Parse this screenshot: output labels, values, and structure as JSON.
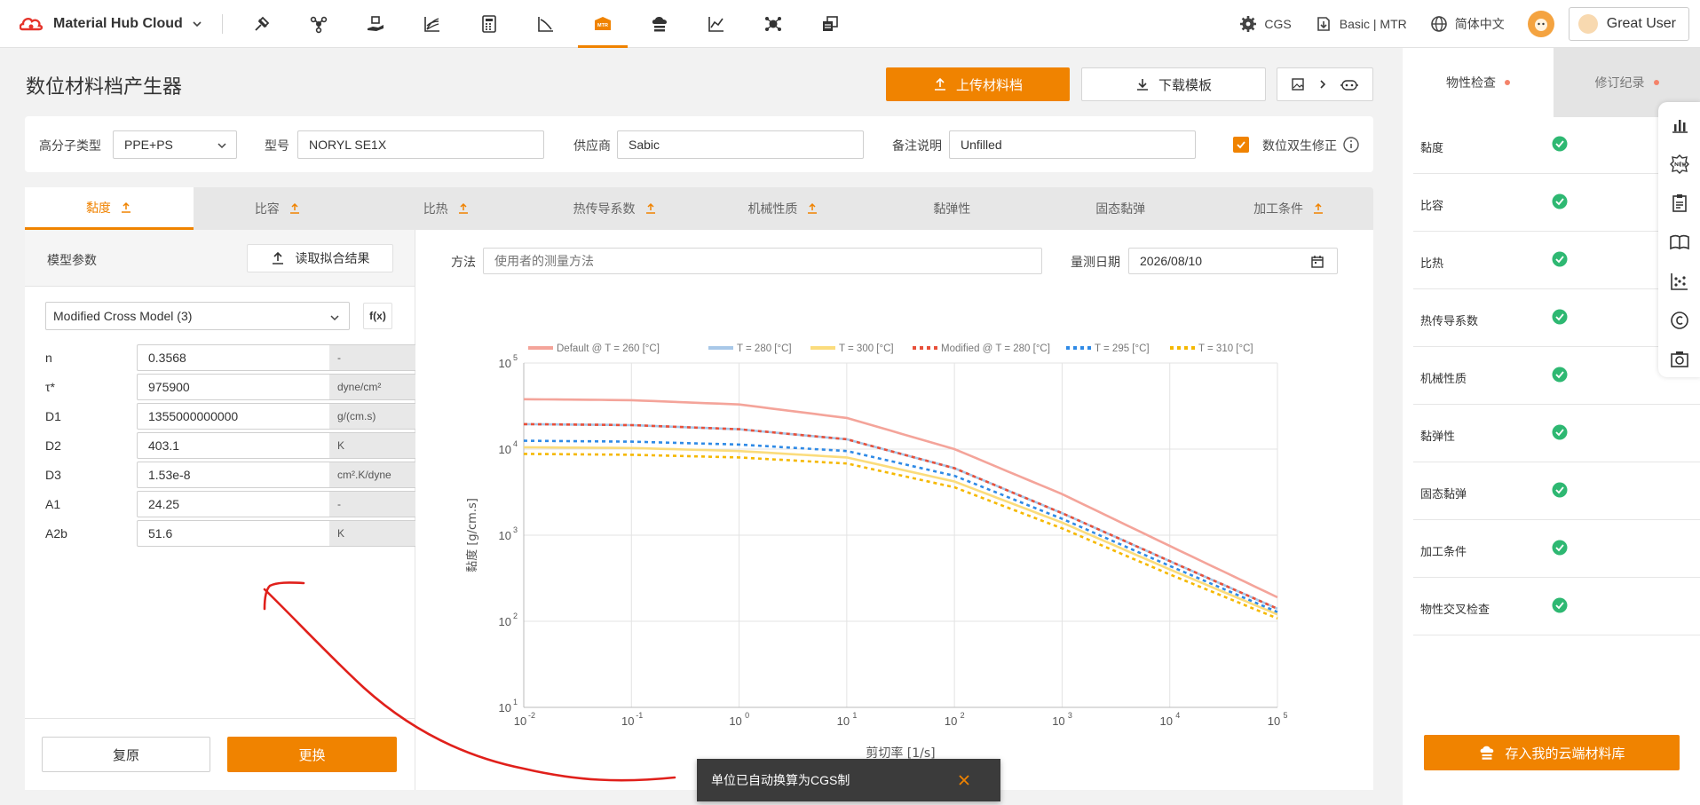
{
  "topbar": {
    "brand": "Material Hub Cloud",
    "nav_icons": [
      "tensile-icon",
      "molecule-icon",
      "hand-material-icon",
      "curves-icon",
      "calculator-icon",
      "angle-chart-icon",
      "mtr-icon",
      "cloud-storage-icon",
      "trend-chart-icon",
      "network-icon",
      "database-icon"
    ],
    "mtr_icon_text": "MTR",
    "unit": "CGS",
    "plan": "Basic | MTR",
    "language": "简体中文",
    "user": "Great User"
  },
  "page": {
    "title": "数位材料档产生器",
    "upload_label": "上传材料档",
    "download_label": "下载模板"
  },
  "properties": {
    "polymer_label": "高分子类型",
    "polymer_value": "PPE+PS",
    "grade_label": "型号",
    "grade_value": "NORYL SE1X",
    "supplier_label": "供应商",
    "supplier_value": "Sabic",
    "note_label": "备注说明",
    "note_value": "Unfilled",
    "twin_label": "数位双生修正"
  },
  "tabs": [
    {
      "label": "黏度",
      "upload": true
    },
    {
      "label": "比容",
      "upload": true
    },
    {
      "label": "比热",
      "upload": true
    },
    {
      "label": "热传导系数",
      "upload": true
    },
    {
      "label": "机械性质",
      "upload": true
    },
    {
      "label": "黏弹性",
      "upload": false
    },
    {
      "label": "固态黏弹",
      "upload": false
    },
    {
      "label": "加工条件",
      "upload": true
    }
  ],
  "model": {
    "header": "模型参数",
    "fit_button": "读取拟合结果",
    "selected": "Modified Cross Model (3)",
    "fx": "f(x)",
    "params": [
      {
        "name": "n",
        "value": "0.3568",
        "unit": "-"
      },
      {
        "name": "τ*",
        "value": "975900",
        "unit": "dyne/cm²"
      },
      {
        "name": "D1",
        "value": "1355000000000",
        "unit": "g/(cm.s)"
      },
      {
        "name": "D2",
        "value": "403.1",
        "unit": "K"
      },
      {
        "name": "D3",
        "value": "1.53e-8",
        "unit": "cm².K/dyne"
      },
      {
        "name": "A1",
        "value": "24.25",
        "unit": "-"
      },
      {
        "name": "A2b",
        "value": "51.6",
        "unit": "K"
      }
    ],
    "reset": "复原",
    "apply": "更换"
  },
  "measure": {
    "method_label": "方法",
    "method_placeholder": "使用者的测量方法",
    "date_label": "量测日期",
    "date_value": "2026/08/10"
  },
  "chart_data": {
    "type": "line",
    "xscale": "log",
    "yscale": "log",
    "xlim": [
      0.01,
      100000
    ],
    "ylim": [
      10,
      100000
    ],
    "x_ticks": [
      -2,
      -1,
      0,
      1,
      2,
      3,
      4,
      5
    ],
    "y_ticks": [
      1,
      2,
      3,
      4,
      5
    ],
    "xlabel": "剪切率 [1/s]",
    "ylabel": "黏度 [g/cm.s]",
    "legend_position": "top",
    "grid": true,
    "x": [
      0.01,
      0.1,
      1,
      10,
      100,
      1000,
      10000,
      100000
    ],
    "series": [
      {
        "name": "Default @ T = 260 [°C]",
        "color": "#f4a49a",
        "dash": false,
        "values": [
          38000,
          37000,
          33000,
          23000,
          10000,
          3000,
          750,
          190
        ]
      },
      {
        "name": "T = 280 [°C]",
        "color": "#a8c8e8",
        "dash": false,
        "values": [
          19500,
          19000,
          17000,
          13000,
          6000,
          1800,
          500,
          140
        ]
      },
      {
        "name": "T = 300 [°C]",
        "color": "#fbdc7c",
        "dash": false,
        "values": [
          10500,
          10300,
          9500,
          8000,
          4200,
          1400,
          400,
          120
        ]
      },
      {
        "name": "Modified @ T = 280 [°C]",
        "color": "#e8503a",
        "dash": true,
        "values": [
          19500,
          19000,
          17000,
          13000,
          6000,
          1800,
          500,
          140
        ]
      },
      {
        "name": "T = 295 [°C]",
        "color": "#2f8ae6",
        "dash": true,
        "values": [
          12500,
          12200,
          11300,
          9500,
          4900,
          1550,
          440,
          128
        ]
      },
      {
        "name": "T = 310 [°C]",
        "color": "#f5b800",
        "dash": true,
        "values": [
          8800,
          8600,
          8000,
          6800,
          3600,
          1200,
          350,
          108
        ]
      }
    ]
  },
  "sidebar": {
    "tab_check": "物性检查",
    "tab_history": "修订纪录",
    "checks": [
      "黏度",
      "比容",
      "比热",
      "热传导系数",
      "机械性质",
      "黏弹性",
      "固态黏弹",
      "加工条件",
      "物性交叉检查"
    ],
    "save": "存入我的云端材料库",
    "float_icons": [
      "bar-chart-icon",
      "new-badge-icon",
      "clipboard-icon",
      "book-icon",
      "scatter-icon",
      "copyright-icon",
      "camera-icon"
    ]
  },
  "toast": {
    "message": "单位已自动换算为CGS制"
  },
  "colors": {
    "accent": "#f08300",
    "check": "#2eb872"
  }
}
